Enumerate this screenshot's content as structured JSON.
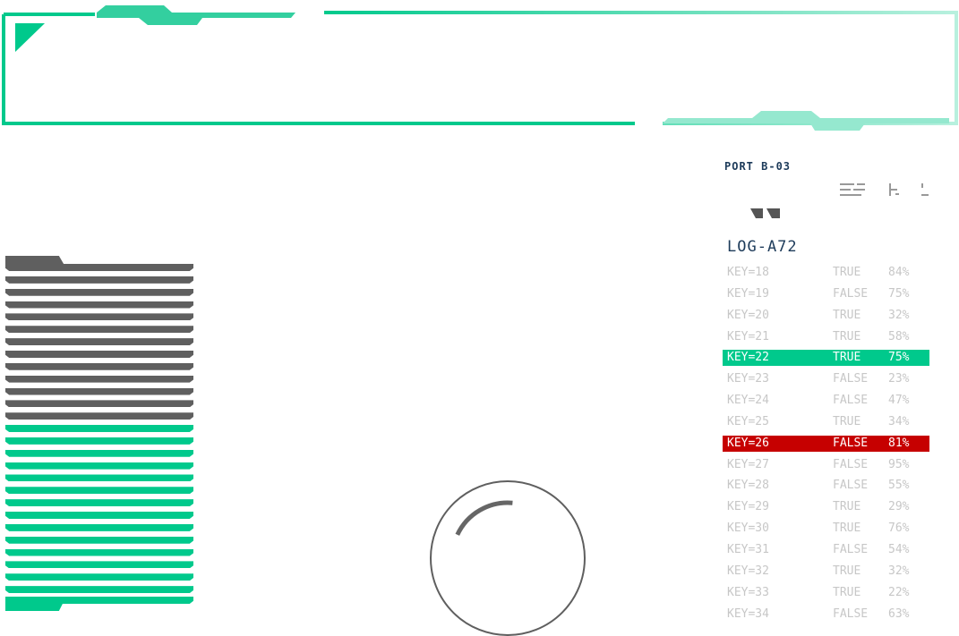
{
  "colors": {
    "accent": "#00c98c",
    "accent_light": "#95e8cf",
    "dark_bar": "#5f5f5f",
    "alert": "#c60000",
    "title": "#1d3b5a",
    "muted_text": "#c7c7c7"
  },
  "panel": {
    "port_label": "PORT B-03",
    "icons": [
      "menu-lines-icon",
      "split-lines-icon",
      "dots-icon",
      "quote-icon"
    ],
    "log_title": "LOG-A72"
  },
  "bars": {
    "dark_count": 13,
    "green_count": 14
  },
  "dial": {
    "arc_start_deg": 205,
    "arc_end_deg": 275
  },
  "log": [
    {
      "key": "KEY=18",
      "value": "TRUE",
      "pct": "84%",
      "state": "normal"
    },
    {
      "key": "KEY=19",
      "value": "FALSE",
      "pct": "75%",
      "state": "normal"
    },
    {
      "key": "KEY=20",
      "value": "TRUE",
      "pct": "32%",
      "state": "normal"
    },
    {
      "key": "KEY=21",
      "value": "TRUE",
      "pct": "58%",
      "state": "normal"
    },
    {
      "key": "KEY=22",
      "value": "TRUE",
      "pct": "75%",
      "state": "selected"
    },
    {
      "key": "KEY=23",
      "value": "FALSE",
      "pct": "23%",
      "state": "normal"
    },
    {
      "key": "KEY=24",
      "value": "FALSE",
      "pct": "47%",
      "state": "normal"
    },
    {
      "key": "KEY=25",
      "value": "TRUE",
      "pct": "34%",
      "state": "normal"
    },
    {
      "key": "KEY=26",
      "value": "FALSE",
      "pct": "81%",
      "state": "alert"
    },
    {
      "key": "KEY=27",
      "value": "FALSE",
      "pct": "95%",
      "state": "normal"
    },
    {
      "key": "KEY=28",
      "value": "FALSE",
      "pct": "55%",
      "state": "normal"
    },
    {
      "key": "KEY=29",
      "value": "TRUE",
      "pct": "29%",
      "state": "normal"
    },
    {
      "key": "KEY=30",
      "value": "TRUE",
      "pct": "76%",
      "state": "normal"
    },
    {
      "key": "KEY=31",
      "value": "FALSE",
      "pct": "54%",
      "state": "normal"
    },
    {
      "key": "KEY=32",
      "value": "TRUE",
      "pct": "32%",
      "state": "normal"
    },
    {
      "key": "KEY=33",
      "value": "TRUE",
      "pct": "22%",
      "state": "normal"
    },
    {
      "key": "KEY=34",
      "value": "FALSE",
      "pct": "63%",
      "state": "normal"
    }
  ]
}
